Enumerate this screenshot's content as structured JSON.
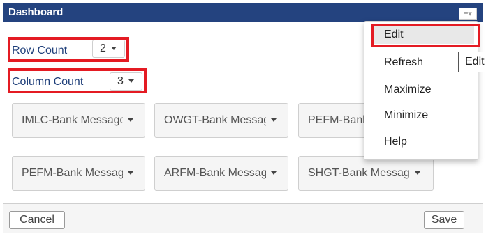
{
  "header": {
    "title": "Dashboard",
    "menu_icon": "hamburger-dropdown-icon"
  },
  "settings": {
    "row_label": "Row Count",
    "row_value": "2",
    "column_label": "Column Count",
    "column_value": "3"
  },
  "widgets": [
    "IMLC-Bank Message",
    "OWGT-Bank Messag",
    "PEFM-Bank Message",
    "PEFM-Bank Messag",
    "ARFM-Bank Messag",
    "SHGT-Bank Messag"
  ],
  "footer": {
    "cancel_label": "Cancel",
    "save_label": "Save"
  },
  "menu": {
    "items": [
      "Edit",
      "Refresh",
      "Maximize",
      "Minimize",
      "Help"
    ],
    "active_item": "Edit"
  },
  "tooltip": {
    "text": "Edit"
  },
  "colors": {
    "header_bg": "#24437f",
    "highlight": "#e41b23",
    "label": "#1f3f7a"
  }
}
